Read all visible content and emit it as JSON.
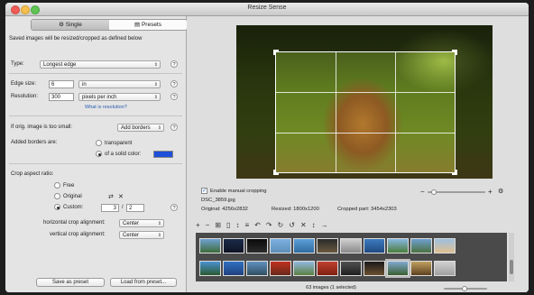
{
  "window": {
    "title": "Resize Sense"
  },
  "tabs": {
    "single": "Single",
    "presets": "Presets"
  },
  "left": {
    "note": "Saved images will be resized/cropped as defined below",
    "type_label": "Type:",
    "type_value": "Longest edge",
    "edge_label": "Edge size:",
    "edge_value": "6",
    "edge_unit": "in",
    "res_label": "Resolution:",
    "res_value": "300",
    "res_unit": "pixels per inch",
    "res_link": "What is resolution?",
    "small_label": "If orig. image is too small:",
    "small_value": "Add borders",
    "borders_label": "Added borders are:",
    "transparent": "transparent",
    "solid": "of a solid color:",
    "solid_color": "#1d4fd8",
    "aspect_label": "Crop aspect ratio:",
    "free": "Free",
    "original": "Original",
    "custom": "Custom:",
    "custom_a": "3",
    "custom_sep": "/",
    "custom_b": "2",
    "hcrop_label": "horizontal crop alignment:",
    "hcrop_value": "Center",
    "vcrop_label": "vertical crop alignment:",
    "vcrop_value": "Center",
    "save_preset": "Save as preset",
    "load_preset": "Load from preset..."
  },
  "preview": {
    "manual_crop": "Enable manual cropping",
    "filename": "DSC_3859.jpg",
    "original": "Original: 4256x2832",
    "resized": "Resized: 1800x1200",
    "cropped": "Cropped part: 3454x2303",
    "zoom_minus": "−",
    "zoom_plus": "+"
  },
  "toolbar": {
    "icons": [
      "+",
      "−",
      "⊞",
      "▯",
      "↕",
      "≡",
      "↶",
      "↷",
      "↻",
      "↺",
      "✕",
      "↕",
      "→"
    ]
  },
  "status": {
    "text": "63 images (1 selected)"
  }
}
